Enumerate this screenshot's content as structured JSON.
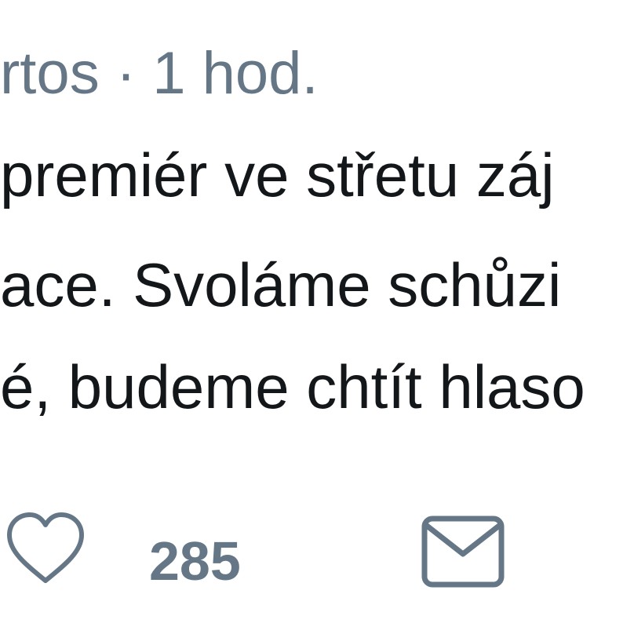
{
  "tweet": {
    "author_fragment": "rtos",
    "separator": "·",
    "time": "1 hod.",
    "lines": [
      "premiér ve střetu záj",
      "ace. Svoláme schůzi",
      "é, budeme chtít hlaso"
    ]
  },
  "actions": {
    "like_icon": "heart-icon",
    "like_count": "285",
    "dm_icon": "envelope-icon"
  },
  "colors": {
    "text": "#14171a",
    "muted": "#657786"
  }
}
